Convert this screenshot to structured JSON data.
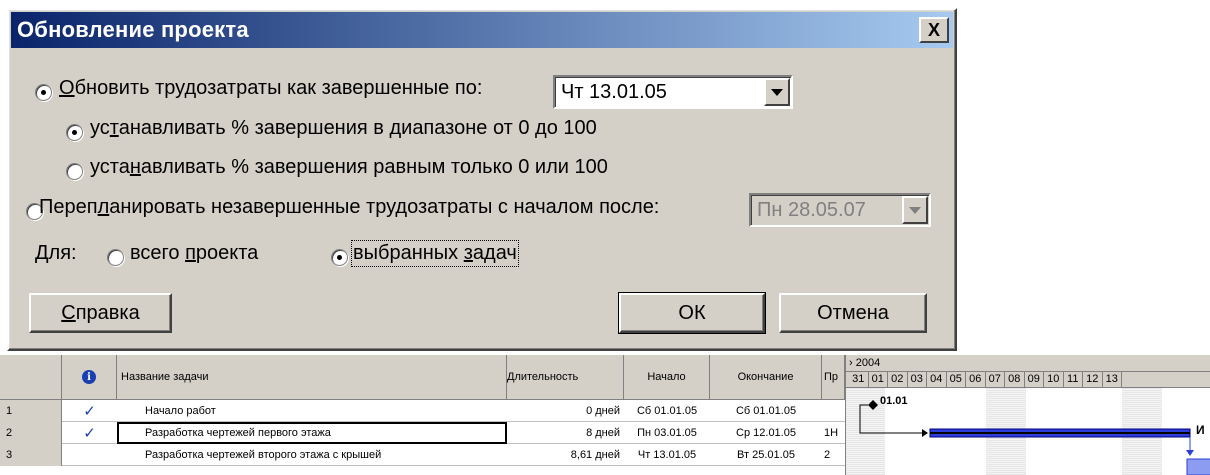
{
  "dialog": {
    "title": "Обновление проекта",
    "close_glyph": "X",
    "opt_update": [
      "",
      "О",
      "бновить трудозатраты как завершенные по:"
    ],
    "update_date": "Чт 13.01.05",
    "opt_sub1": [
      "ус",
      "т",
      "анавливать % завершения в диапазоне от 0 до 100"
    ],
    "opt_sub2": [
      "уста",
      "н",
      "авливать % завершения равным только 0 или 100"
    ],
    "opt_replan": [
      "Переп",
      "л",
      "анировать незавершенные трудозатраты с началом после:"
    ],
    "replan_date": "Пн 28.05.07",
    "for_label": "Для:",
    "opt_whole": [
      "всего ",
      "п",
      "роекта"
    ],
    "opt_selected": [
      "выбранных ",
      "з",
      "адач"
    ],
    "help_button": [
      "",
      "С",
      "правка"
    ],
    "ok_button": "ОК",
    "cancel_button": "Отмена"
  },
  "sheet": {
    "headers": {
      "name": "Название задачи",
      "duration": "Длительность",
      "start": "Начало",
      "finish": "Окончание",
      "pred": "Пр"
    },
    "rows": [
      {
        "num": "1",
        "done": true,
        "name": "Начало работ",
        "duration": "0 дней",
        "start": "Сб 01.01.05",
        "finish": "Сб 01.01.05",
        "pred": ""
      },
      {
        "num": "2",
        "done": true,
        "name": "Разработка чертежей первого этажа",
        "duration": "8 дней",
        "start": "Пн 03.01.05",
        "finish": "Ср 12.01.05",
        "pred": "1Н"
      },
      {
        "num": "3",
        "done": false,
        "name": "Разработка чертежей второго этажа с крышей",
        "duration": "8,61 дней",
        "start": "Чт 13.01.05",
        "finish": "Вт 25.01.05",
        "pred": "2"
      }
    ],
    "check_glyph": "✓",
    "info_glyph": "i"
  },
  "gantt": {
    "period": "› 2004",
    "days": [
      "31",
      "01",
      "02",
      "03",
      "04",
      "05",
      "06",
      "07",
      "08",
      "09",
      "10",
      "11",
      "12",
      "13"
    ],
    "milestone_label": "01.01",
    "bar_tail_label": "И",
    "colors": {
      "bar": "#2c3fd8",
      "bar_dark": "#000080",
      "title_left": "#0a246a",
      "title_right": "#a6caf0",
      "face": "#d4d0c8"
    }
  }
}
